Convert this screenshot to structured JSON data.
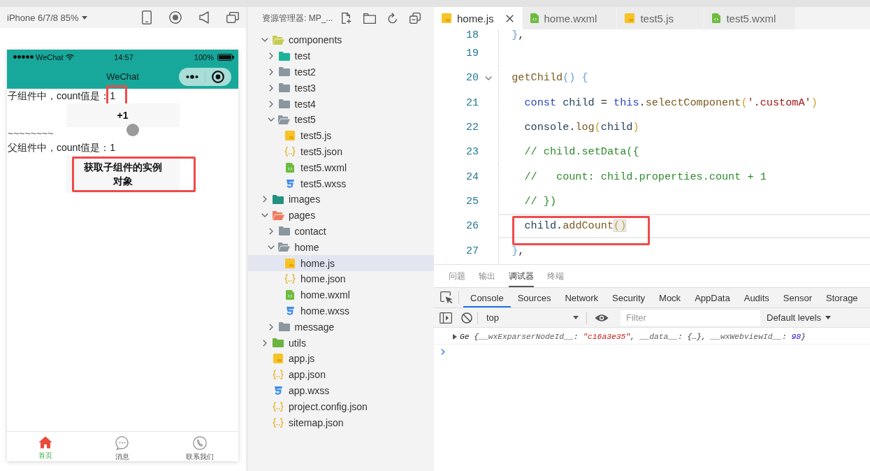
{
  "simulator": {
    "device": "iPhone 6/7/8 85%",
    "status_bar": {
      "carrier": "WeChat",
      "time": "14:57",
      "battery": "100%"
    },
    "nav_title": "WeChat",
    "content": [
      {
        "kind": "label-value",
        "label": "子组件中，count值是：",
        "value": "1",
        "highlighted": true
      },
      {
        "kind": "button",
        "label": "+1",
        "highlighted": false
      },
      {
        "kind": "text",
        "text": "~~~~~~~~",
        "highlighted": false
      },
      {
        "kind": "label-value",
        "label": "父组件中，count值是：",
        "value": "1",
        "highlighted": false
      },
      {
        "kind": "button",
        "label": "获取子组件的实例对象",
        "highlighted": true
      }
    ],
    "tab_bar": [
      {
        "kind": "home",
        "label": "首页",
        "selected": true
      },
      {
        "kind": "chat",
        "label": "消息",
        "selected": false
      },
      {
        "kind": "phone",
        "label": "联系我们",
        "selected": false
      }
    ]
  },
  "explorer": {
    "title": "资源管理器: MP_...",
    "tree": [
      {
        "name": "components",
        "kind": "folder",
        "color": "#c6cc4c",
        "expanded": true,
        "selected": false,
        "children": [
          {
            "name": "test",
            "kind": "folder",
            "color": "#1cb39b",
            "expanded": false,
            "selected": false
          },
          {
            "name": "test2",
            "kind": "folder",
            "color": "#8a979f",
            "expanded": false,
            "selected": false
          },
          {
            "name": "test3",
            "kind": "folder",
            "color": "#8a979f",
            "expanded": false,
            "selected": false
          },
          {
            "name": "test4",
            "kind": "folder",
            "color": "#8a979f",
            "expanded": false,
            "selected": false
          },
          {
            "name": "test5",
            "kind": "folder",
            "color": "#8a979f",
            "expanded": true,
            "selected": false,
            "children": [
              {
                "name": "test5.js",
                "kind": "js",
                "selected": false
              },
              {
                "name": "test5.json",
                "kind": "json",
                "selected": false
              },
              {
                "name": "test5.wxml",
                "kind": "wxml",
                "selected": false
              },
              {
                "name": "test5.wxss",
                "kind": "wxss",
                "selected": false
              }
            ]
          }
        ]
      },
      {
        "name": "images",
        "kind": "folder",
        "color": "#23917f",
        "expanded": false,
        "selected": false
      },
      {
        "name": "pages",
        "kind": "folder",
        "color": "#f07a5c",
        "expanded": true,
        "selected": false,
        "children": [
          {
            "name": "contact",
            "kind": "folder",
            "color": "#8a979f",
            "expanded": false,
            "selected": false
          },
          {
            "name": "home",
            "kind": "folder",
            "color": "#8a979f",
            "expanded": true,
            "selected": false,
            "children": [
              {
                "name": "home.js",
                "kind": "js",
                "selected": true
              },
              {
                "name": "home.json",
                "kind": "json",
                "selected": false
              },
              {
                "name": "home.wxml",
                "kind": "wxml",
                "selected": false
              },
              {
                "name": "home.wxss",
                "kind": "wxss",
                "selected": false
              }
            ]
          },
          {
            "name": "message",
            "kind": "folder",
            "color": "#8a979f",
            "expanded": false,
            "selected": false
          }
        ]
      },
      {
        "name": "utils",
        "kind": "folder",
        "color": "#6cb33f",
        "expanded": false,
        "selected": false
      },
      {
        "name": "app.js",
        "kind": "js",
        "selected": false
      },
      {
        "name": "app.json",
        "kind": "json",
        "selected": false
      },
      {
        "name": "app.wxss",
        "kind": "wxss",
        "selected": false
      },
      {
        "name": "project.config.json",
        "kind": "json",
        "selected": false
      },
      {
        "name": "sitemap.json",
        "kind": "json",
        "selected": false
      }
    ]
  },
  "editor": {
    "tabs": [
      {
        "kind": "js",
        "label": "home.js",
        "selected": true
      },
      {
        "kind": "wxml",
        "label": "home.wxml",
        "selected": false
      },
      {
        "kind": "js",
        "label": "test5.js",
        "selected": false
      },
      {
        "kind": "wxml",
        "label": "test5.wxml",
        "selected": false
      }
    ],
    "lines": [
      {
        "number": "18",
        "tokens": [
          {
            "text": "  }",
            "kind": "bracket-outer"
          },
          {
            "text": ",",
            "kind": "punct"
          }
        ],
        "fold": false,
        "current": false,
        "highlighted": false
      },
      {
        "number": "19",
        "fold": false,
        "current": false,
        "highlighted": false
      },
      {
        "number": "20",
        "tokens": [
          {
            "text": "  getChild",
            "kind": "function"
          },
          {
            "text": "() {",
            "kind": "bracket-outer"
          }
        ],
        "fold": true,
        "current": false,
        "highlighted": false
      },
      {
        "number": "21",
        "tokens": [
          {
            "text": "    const",
            "kind": "keyword"
          },
          {
            "text": " child",
            "kind": "variable"
          },
          {
            "text": " = ",
            "kind": "punct"
          },
          {
            "text": "this",
            "kind": "keyword"
          },
          {
            "text": ".",
            "kind": "punct"
          },
          {
            "text": "selectComponent",
            "kind": "function"
          },
          {
            "text": "(",
            "kind": "bracket-inner"
          },
          {
            "text": "'.customA'",
            "kind": "string"
          },
          {
            "text": ")",
            "kind": "bracket-inner"
          }
        ],
        "fold": false,
        "current": false,
        "highlighted": false
      },
      {
        "number": "22",
        "tokens": [
          {
            "text": "    console",
            "kind": "variable"
          },
          {
            "text": ".",
            "kind": "punct"
          },
          {
            "text": "log",
            "kind": "function"
          },
          {
            "text": "(",
            "kind": "bracket-inner"
          },
          {
            "text": "child",
            "kind": "variable"
          },
          {
            "text": ")",
            "kind": "bracket-inner"
          }
        ],
        "fold": false,
        "current": false,
        "highlighted": false
      },
      {
        "number": "23",
        "tokens": [
          {
            "text": "    // child.setData({",
            "kind": "comment"
          }
        ],
        "fold": false,
        "current": false,
        "highlighted": false
      },
      {
        "number": "24",
        "tokens": [
          {
            "text": "    //   count: child.properties.count + 1",
            "kind": "comment"
          }
        ],
        "fold": false,
        "current": false,
        "highlighted": false
      },
      {
        "number": "25",
        "tokens": [
          {
            "text": "    // })",
            "kind": "comment"
          }
        ],
        "fold": false,
        "current": false,
        "highlighted": false
      },
      {
        "number": "26",
        "tokens": [
          {
            "text": "    child",
            "kind": "variable"
          },
          {
            "text": ".",
            "kind": "punct"
          },
          {
            "text": "addCount",
            "kind": "function"
          },
          {
            "text": "()",
            "kind": "bracket-match"
          }
        ],
        "fold": false,
        "current": true,
        "highlighted": true
      },
      {
        "number": "27",
        "tokens": [
          {
            "text": "  }",
            "kind": "bracket-outer"
          },
          {
            "text": ",",
            "kind": "punct"
          }
        ],
        "fold": false,
        "current": false,
        "highlighted": false
      }
    ]
  },
  "devtools": {
    "panel_tabs": [
      {
        "label": "问题",
        "selected": false
      },
      {
        "label": "输出",
        "selected": false
      },
      {
        "label": "调试器",
        "selected": true
      },
      {
        "label": "终端",
        "selected": false
      }
    ],
    "tabs": [
      {
        "label": "Console",
        "selected": true
      },
      {
        "label": "Sources",
        "selected": false
      },
      {
        "label": "Network",
        "selected": false
      },
      {
        "label": "Security",
        "selected": false
      },
      {
        "label": "Mock",
        "selected": false
      },
      {
        "label": "AppData",
        "selected": false
      },
      {
        "label": "Audits",
        "selected": false
      },
      {
        "label": "Sensor",
        "selected": false
      },
      {
        "label": "Storage",
        "selected": false
      }
    ],
    "context": "top",
    "filter": {
      "placeholder": "Filter"
    },
    "levels": "Default levels",
    "console": [
      {
        "expanded": false,
        "tokens": [
          {
            "text": "Ge ",
            "kind": "name"
          },
          {
            "text": "{",
            "kind": "punct"
          },
          {
            "text": "__wxExparserNodeId__",
            "kind": "key"
          },
          {
            "text": ": ",
            "kind": "punct"
          },
          {
            "text": "\"c16a3e35\"",
            "kind": "string"
          },
          {
            "text": ", ",
            "kind": "punct"
          },
          {
            "text": "__data__",
            "kind": "key"
          },
          {
            "text": ": {…}, ",
            "kind": "punct"
          },
          {
            "text": "__wxWebviewId__",
            "kind": "key"
          },
          {
            "text": ": ",
            "kind": "punct"
          },
          {
            "text": "98",
            "kind": "number"
          },
          {
            "text": "}",
            "kind": "punct"
          }
        ]
      }
    ]
  }
}
